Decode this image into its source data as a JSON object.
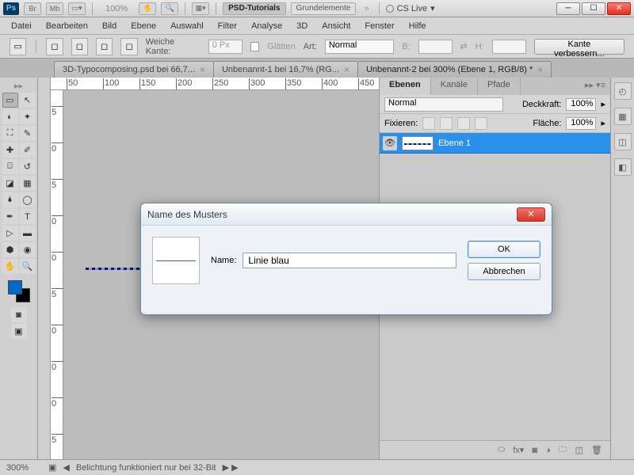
{
  "titlebar": {
    "zoom": "100%",
    "btn1": "Br",
    "btn2": "Mb",
    "psd_tutorials": "PSD-Tutorials",
    "grundelemente": "Grundelemente",
    "cs_live": "CS Live"
  },
  "menu": {
    "items": [
      "Datei",
      "Bearbeiten",
      "Bild",
      "Ebene",
      "Auswahl",
      "Filter",
      "Analyse",
      "3D",
      "Ansicht",
      "Fenster",
      "Hilfe"
    ]
  },
  "options": {
    "weiche_kante": "Weiche Kante:",
    "weiche_kante_val": "0 Px",
    "glatten": "Glätten",
    "art": "Art:",
    "art_val": "Normal",
    "b": "B:",
    "h": "H:",
    "kante_btn": "Kante verbessern..."
  },
  "tabs": {
    "t1": "3D-Typocomposing.psd bei 66,7...",
    "t2": "Unbenannt-1 bei 16,7% (RG...",
    "t3": "Unbenannt-2 bei 300% (Ebene 1, RGB/8) *"
  },
  "ruler_h": [
    "50",
    "100",
    "150",
    "200",
    "250",
    "300",
    "350",
    "400",
    "450"
  ],
  "ruler_v": [
    "5",
    "0",
    "5",
    "0",
    "0",
    "5",
    "0",
    "0",
    "0",
    "5"
  ],
  "panel": {
    "tabs": [
      "Ebenen",
      "Kanäle",
      "Pfade"
    ],
    "blend": "Normal",
    "deckkraft_lbl": "Deckkraft:",
    "deckkraft_val": "100%",
    "fixieren_lbl": "Fixieren:",
    "flache_lbl": "Fläche:",
    "flache_val": "100%",
    "layer1": "Ebene 1"
  },
  "status": {
    "zoom": "300%",
    "msg": "Belichtung funktioniert nur bei 32-Bit"
  },
  "dialog": {
    "title": "Name des Musters",
    "name_lbl": "Name:",
    "name_val": "Linie blau",
    "ok": "OK",
    "cancel": "Abbrechen"
  }
}
